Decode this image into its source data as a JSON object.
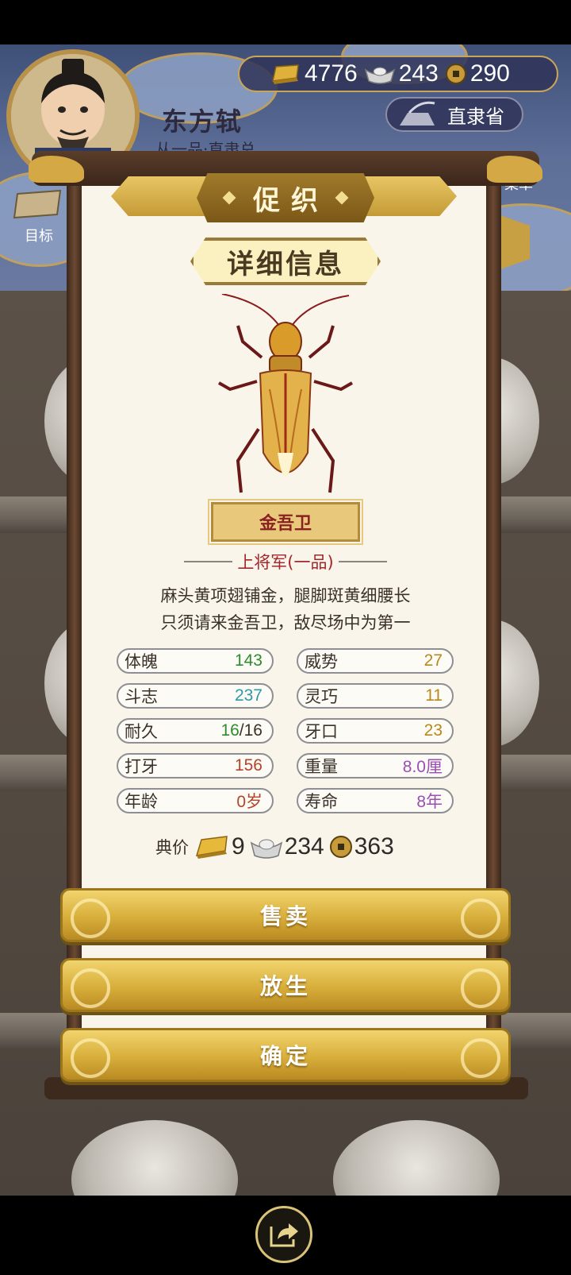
{
  "player": {
    "name": "东方轼",
    "rank": "从一品·直隶总"
  },
  "currency": {
    "gold": "4776",
    "silver": "243",
    "coin": "290"
  },
  "province": "直隶省",
  "hud": {
    "goal_label": "目标",
    "menu_label": "菜单"
  },
  "panel": {
    "title": "促织",
    "detail_header": "详细信息",
    "cricket_name": "金吾卫",
    "rank": "上将军(一品)",
    "description": [
      "麻头黄项翅铺金，腿脚斑黄细腰长",
      "只须请来金吾卫，敌尽场中为第一"
    ]
  },
  "stats": {
    "left": [
      {
        "label": "体魄",
        "value": "143",
        "color": "#2e8b2e"
      },
      {
        "label": "斗志",
        "value": "237",
        "color": "#2e9aa6"
      },
      {
        "label": "耐久",
        "value_a": "16",
        "value_b": "/16",
        "color": "#2e8b2e"
      },
      {
        "label": "打牙",
        "value": "156",
        "color": "#b2442a"
      },
      {
        "label": "年龄",
        "value": "0岁",
        "color": "#b2442a"
      }
    ],
    "right": [
      {
        "label": "威势",
        "value": "27",
        "color": "#b5891f"
      },
      {
        "label": "灵巧",
        "value": "11",
        "color": "#b5891f"
      },
      {
        "label": "牙口",
        "value": "23",
        "color": "#b5891f"
      },
      {
        "label": "重量",
        "value": "8.0厘",
        "color": "#9a4fb5"
      },
      {
        "label": "寿命",
        "value": "8年",
        "color": "#9a4fb5"
      }
    ]
  },
  "price": {
    "label": "典价",
    "gold": "9",
    "silver": "234",
    "coin": "363"
  },
  "buttons": {
    "sell": "售卖",
    "release": "放生",
    "confirm": "确定"
  }
}
